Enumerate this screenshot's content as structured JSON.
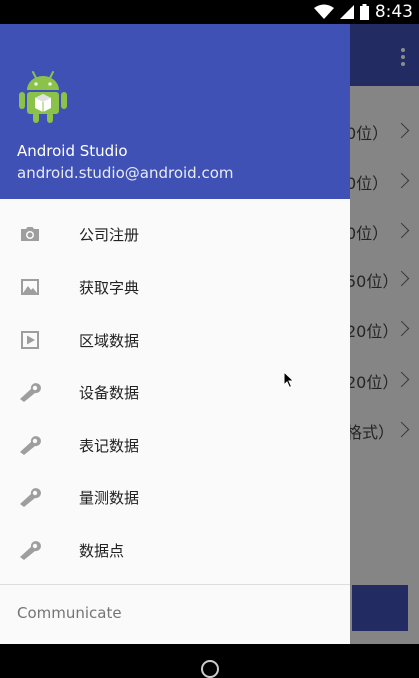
{
  "status_bar": {
    "time": "8:43"
  },
  "background_list": {
    "items": [
      {
        "text": "0位）"
      },
      {
        "text": "0位）"
      },
      {
        "text": "0位）"
      },
      {
        "text": "50位）"
      },
      {
        "text": "20位）"
      },
      {
        "text": "20位）"
      },
      {
        "text": "格式）"
      }
    ]
  },
  "drawer": {
    "header": {
      "name": "Android Studio",
      "email": "android.studio@android.com"
    },
    "items": [
      {
        "label": "公司注册",
        "icon": "camera-icon"
      },
      {
        "label": "获取字典",
        "icon": "image-icon"
      },
      {
        "label": "区域数据",
        "icon": "play-box-icon"
      },
      {
        "label": "设备数据",
        "icon": "wrench-icon"
      },
      {
        "label": "表记数据",
        "icon": "wrench-icon"
      },
      {
        "label": "量测数据",
        "icon": "wrench-icon"
      },
      {
        "label": "数据点",
        "icon": "wrench-icon"
      }
    ],
    "section_label": "Communicate"
  },
  "colors": {
    "primary": "#3f51b5",
    "android_green": "#8bc34a"
  }
}
